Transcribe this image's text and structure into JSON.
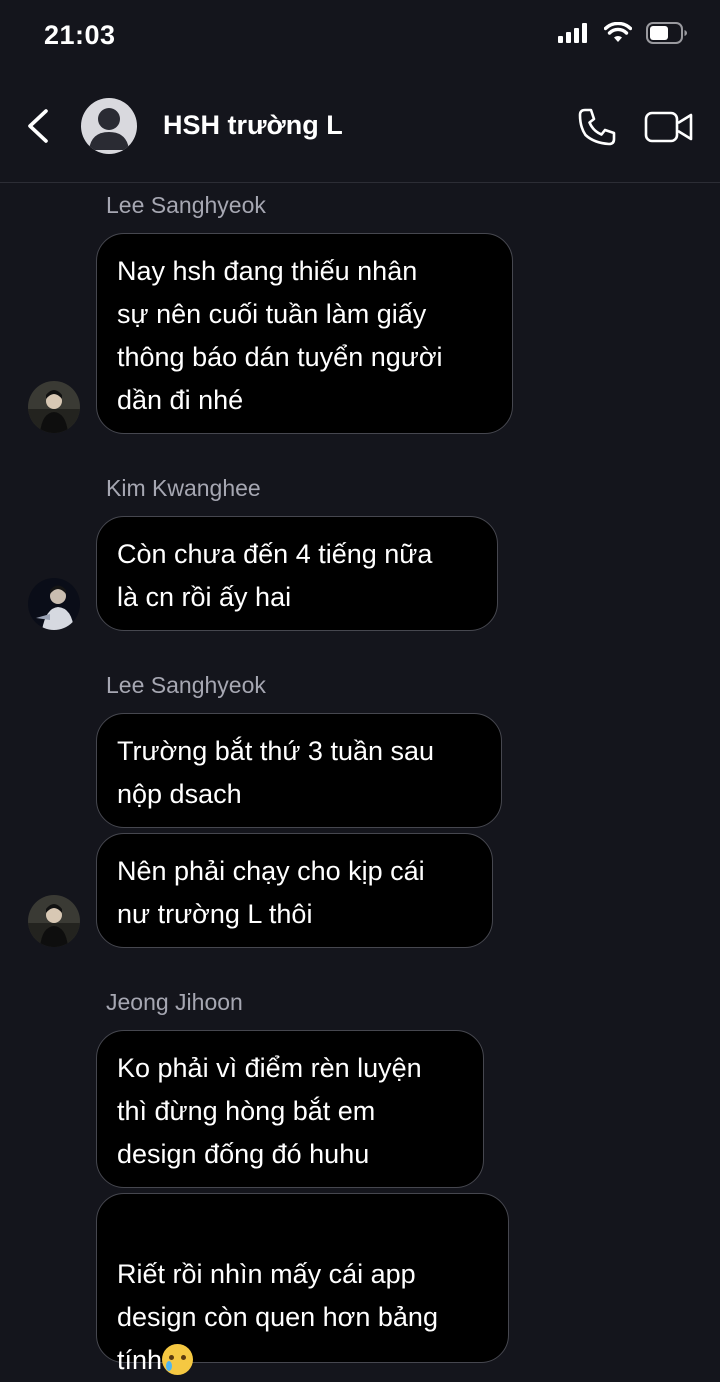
{
  "status_bar": {
    "time": "21:03",
    "icons": [
      "signal-icon",
      "wifi-icon",
      "battery-icon"
    ]
  },
  "header": {
    "title": "HSH trường L",
    "icons": [
      "back-icon",
      "avatar-placeholder-icon",
      "phone-icon",
      "video-camera-icon"
    ]
  },
  "messages": [
    {
      "sender": "Lee Sanghyeok",
      "bubbles": [
        "Nay hsh đang thiếu nhân\nsự nên cuối tuần làm giấy\nthông báo dán tuyển người\ndần đi nhé"
      ]
    },
    {
      "sender": "Kim Kwanghee",
      "bubbles": [
        "Còn chưa đến 4 tiếng nữa\nlà cn rồi ấy hai"
      ]
    },
    {
      "sender": "Lee Sanghyeok",
      "bubbles": [
        "Trường bắt thứ 3 tuần sau\nnộp dsach",
        "Nên phải chạy cho kịp cái\nnư trường L thôi"
      ]
    },
    {
      "sender": "Jeong Jihoon",
      "bubbles": [
        "Ko phải vì điểm rèn luyện\nthì đừng hòng bắt em\ndesign đống đó huhu",
        "Riết rồi nhìn mấy cái app\ndesign còn quen hơn bảng\ntính"
      ]
    }
  ],
  "emoji": {
    "name": "face-holding-back-tears-icon"
  },
  "colors": {
    "background": "#14151c",
    "bubble": "#000000",
    "bubble_border": "#46474f",
    "sender": "#a6a7b2"
  }
}
